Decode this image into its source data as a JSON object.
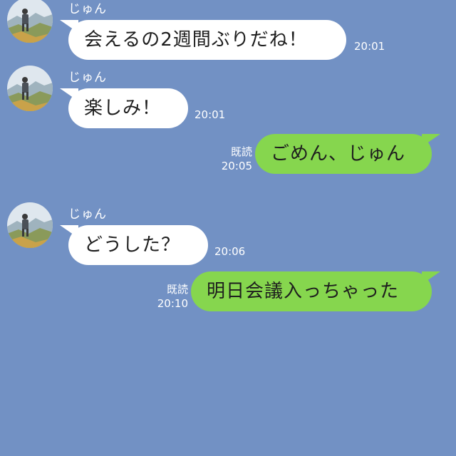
{
  "contact": {
    "name": "じゅん"
  },
  "messages": [
    {
      "direction": "in",
      "text": "会えるの2週間ぶりだね！",
      "time": "20:01"
    },
    {
      "direction": "in",
      "text": "楽しみ！",
      "time": "20:01"
    },
    {
      "direction": "out",
      "text": "ごめん、じゅん",
      "time": "20:05",
      "read": "既読"
    },
    {
      "direction": "in",
      "text": "どうした？",
      "time": "20:06"
    },
    {
      "direction": "out",
      "text": "明日会議入っちゃった",
      "time": "20:10",
      "read": "既読"
    }
  ],
  "colors": {
    "background": "#7291c4",
    "incoming_bubble": "#ffffff",
    "outgoing_bubble": "#86d64e",
    "meta_text": "#ffffff"
  }
}
